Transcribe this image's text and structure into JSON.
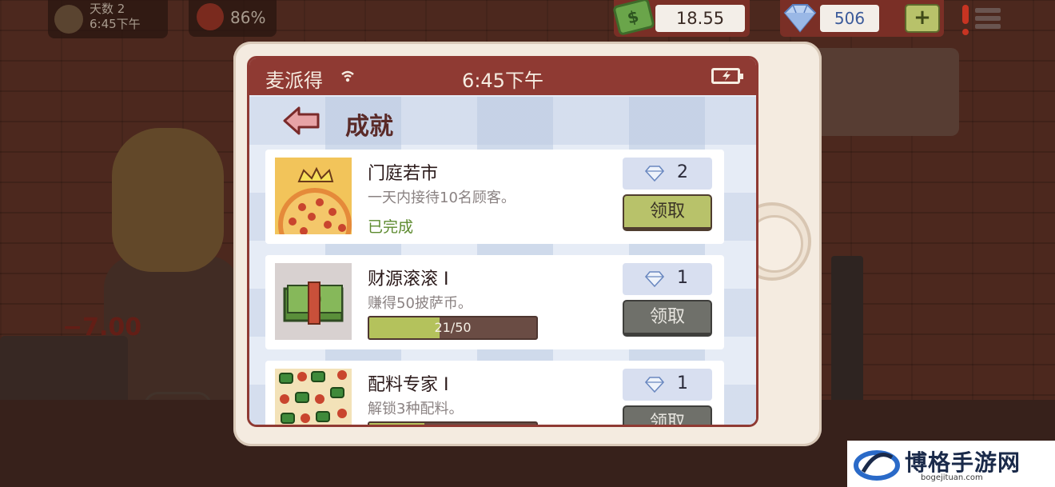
{
  "hud": {
    "day_label": "天数",
    "day_value": "2",
    "clock": "6:45下午",
    "satisfaction": "86%",
    "cash": "18.55",
    "gems": "506",
    "add_gems": "+",
    "floating_money": "−7.00"
  },
  "phone": {
    "carrier": "麦派得",
    "time": "6:45下午",
    "page_title": "成就"
  },
  "achievements": [
    {
      "name": "门庭若市",
      "description": "一天内接待10名顾客。",
      "status": "已完成",
      "reward": "2",
      "claim_label": "领取",
      "claimable": true,
      "thumbnail": "pizza-crown-icon"
    },
    {
      "name": "财源滚滚 Ⅰ",
      "description": "赚得50披萨币。",
      "progress_text": "21/50",
      "progress": 0.42,
      "reward": "1",
      "claim_label": "领取",
      "claimable": false,
      "thumbnail": "cash-stack-icon"
    },
    {
      "name": "配料专家 Ⅰ",
      "description": "解锁3种配料。",
      "progress": 0.33,
      "reward": "1",
      "claim_label": "领取",
      "claimable": false,
      "thumbnail": "toppings-icon"
    }
  ],
  "watermark": {
    "main": "博格手游网",
    "sub": "bogejituan.com"
  },
  "colors": {
    "frame_red": "#8f3a33",
    "claim_active": "#b8c26a",
    "claim_inactive": "#6f706a",
    "progress_fill": "#b4c25c",
    "completed_green": "#5c8a2e"
  }
}
